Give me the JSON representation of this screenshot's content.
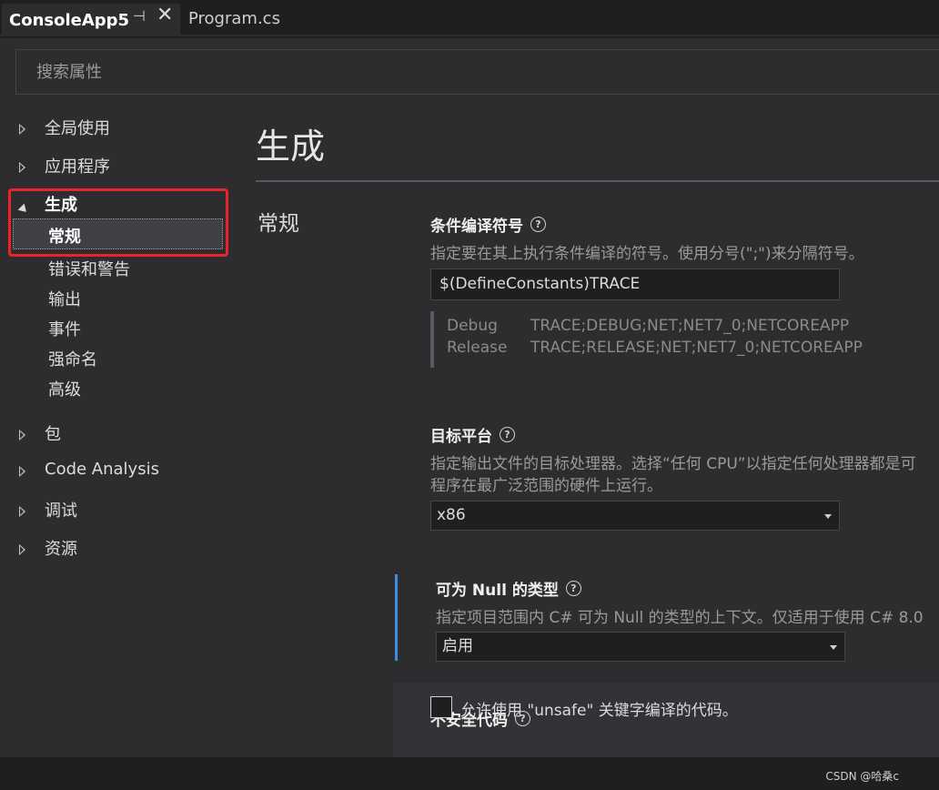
{
  "tabs": {
    "active": {
      "title": "ConsoleApp5",
      "pin_glyph": "⊣",
      "close_glyph": "✕"
    },
    "inactive": {
      "title": "Program.cs"
    }
  },
  "search": {
    "placeholder": "搜索属性",
    "value": ""
  },
  "sidebar": {
    "groups": [
      {
        "label": "全局使用",
        "expanded": false
      },
      {
        "label": "应用程序",
        "expanded": false
      },
      {
        "label": "生成",
        "expanded": true
      },
      {
        "label": "包",
        "expanded": false
      },
      {
        "label": "Code Analysis",
        "expanded": false
      },
      {
        "label": "调试",
        "expanded": false
      },
      {
        "label": "资源",
        "expanded": false
      }
    ],
    "build_children": [
      "常规",
      "错误和警告",
      "输出",
      "事件",
      "强命名",
      "高级"
    ],
    "selected": "常规"
  },
  "content": {
    "page_title": "生成",
    "section_title": "常规",
    "define_constants": {
      "label": "条件编译符号",
      "description": "指定要在其上执行条件编译的符号。使用分号(\";\")来分隔符号。",
      "value": "$(DefineConstants)TRACE",
      "configs": [
        {
          "name": "Debug",
          "value": "TRACE;DEBUG;NET;NET7_0;NETCOREAPP"
        },
        {
          "name": "Release",
          "value": "TRACE;RELEASE;NET;NET7_0;NETCOREAPP"
        }
      ]
    },
    "platform_target": {
      "label": "目标平台",
      "description_line1": "指定输出文件的目标处理器。选择“任何 CPU”以指定任何处理器都是可",
      "description_line2": "程序在最广泛范围的硬件上运行。",
      "value": "x86"
    },
    "nullable": {
      "label": "可为 Null 的类型",
      "description": "指定项目范围内 C# 可为 Null 的类型的上下文。仅适用于使用 C# 8.0",
      "value": "启用"
    },
    "unsafe": {
      "label": "不安全代码",
      "checkbox_label": "允许使用 \"unsafe\" 关键字编译的代码。",
      "checked": false
    }
  },
  "watermark": "CSDN @哈桑c",
  "colors": {
    "highlight_box": "#e8232a",
    "accent_bar": "#3c8ce0",
    "background": "#2d2d30"
  }
}
